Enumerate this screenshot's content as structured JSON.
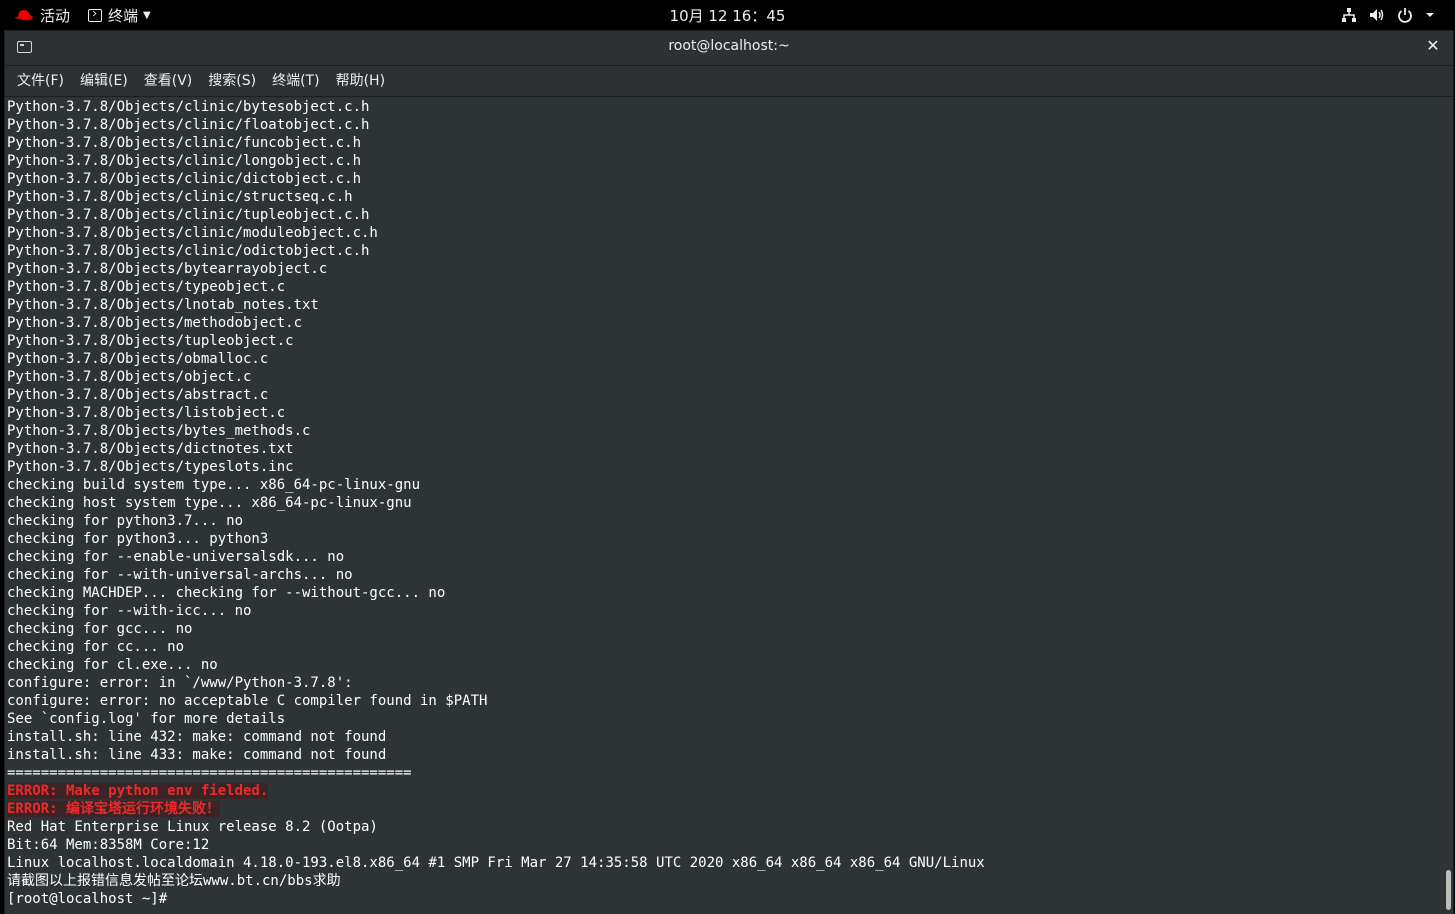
{
  "topbar": {
    "activities_label": "活动",
    "app_name": "终端",
    "clock": "10月 12 16：45",
    "tray_icons": [
      "network-icon",
      "volume-icon",
      "power-icon"
    ]
  },
  "window": {
    "title": "root@localhost:~",
    "close_glyph": "✕"
  },
  "menubar": {
    "items": [
      "文件(F)",
      "编辑(E)",
      "查看(V)",
      "搜索(S)",
      "终端(T)",
      "帮助(H)"
    ]
  },
  "terminal": {
    "lines": [
      "Python-3.7.8/Objects/clinic/bytesobject.c.h",
      "Python-3.7.8/Objects/clinic/floatobject.c.h",
      "Python-3.7.8/Objects/clinic/funcobject.c.h",
      "Python-3.7.8/Objects/clinic/longobject.c.h",
      "Python-3.7.8/Objects/clinic/dictobject.c.h",
      "Python-3.7.8/Objects/clinic/structseq.c.h",
      "Python-3.7.8/Objects/clinic/tupleobject.c.h",
      "Python-3.7.8/Objects/clinic/moduleobject.c.h",
      "Python-3.7.8/Objects/clinic/odictobject.c.h",
      "Python-3.7.8/Objects/bytearrayobject.c",
      "Python-3.7.8/Objects/typeobject.c",
      "Python-3.7.8/Objects/lnotab_notes.txt",
      "Python-3.7.8/Objects/methodobject.c",
      "Python-3.7.8/Objects/tupleobject.c",
      "Python-3.7.8/Objects/obmalloc.c",
      "Python-3.7.8/Objects/object.c",
      "Python-3.7.8/Objects/abstract.c",
      "Python-3.7.8/Objects/listobject.c",
      "Python-3.7.8/Objects/bytes_methods.c",
      "Python-3.7.8/Objects/dictnotes.txt",
      "Python-3.7.8/Objects/typeslots.inc",
      "checking build system type... x86_64-pc-linux-gnu",
      "checking host system type... x86_64-pc-linux-gnu",
      "checking for python3.7... no",
      "checking for python3... python3",
      "checking for --enable-universalsdk... no",
      "checking for --with-universal-archs... no",
      "checking MACHDEP... checking for --without-gcc... no",
      "checking for --with-icc... no",
      "checking for gcc... no",
      "checking for cc... no",
      "checking for cl.exe... no",
      "configure: error: in `/www/Python-3.7.8':",
      "configure: error: no acceptable C compiler found in $PATH",
      "See `config.log' for more details",
      "install.sh: line 432: make: command not found",
      "install.sh: line 433: make: command not found",
      "================================================",
      "ERROR: Make python env fielded.",
      "ERROR: 编译宝塔运行环境失败！",
      "Red Hat Enterprise Linux release 8.2 (Ootpa)",
      "Bit:64 Mem:8358M Core:12",
      "Linux localhost.localdomain 4.18.0-193.el8.x86_64 #1 SMP Fri Mar 27 14:35:58 UTC 2020 x86_64 x86_64 x86_64 GNU/Linux",
      "请截图以上报错信息发帖至论坛www.bt.cn/bbs求助",
      "[root@localhost ~]#"
    ],
    "error_line_indices": [
      38,
      39
    ],
    "colors": {
      "background": "#2e3436",
      "foreground": "#ffffff",
      "error": "#ef2929"
    }
  }
}
